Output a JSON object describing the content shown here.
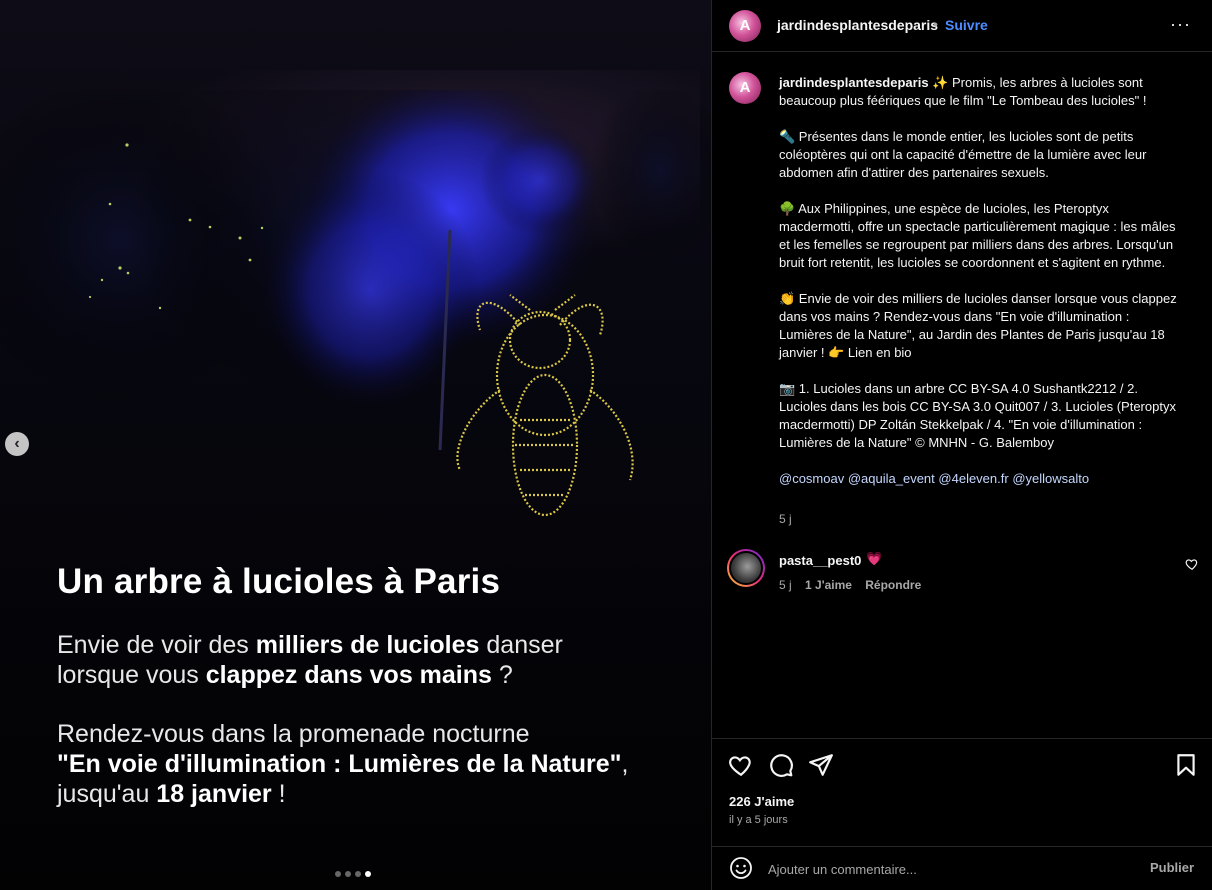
{
  "media": {
    "title": "Un arbre à lucioles à Paris",
    "p1": {
      "l1a": "Envie de voir des ",
      "l1b": "milliers de lucioles",
      "l1c": " danser",
      "l2a": "lorsque vous ",
      "l2b": "clappez dans vos mains",
      "l2c": " ?"
    },
    "p2": {
      "l1": "Rendez-vous dans la promenade nocturne",
      "l2a": "\"En voie d'illumination : Lumières de la Nature\"",
      "l2b": ",",
      "l3a": "jusqu'au ",
      "l3b": "18 janvier",
      "l3c": " !"
    },
    "prev_glyph": "‹",
    "slide_count": 4,
    "active_slide": 4
  },
  "post": {
    "avatar_letter": "A",
    "username": "jardindesplantesdeparis",
    "separator": "•",
    "follow_label": "Suivre",
    "more_glyph": "···"
  },
  "caption": {
    "username": "jardindesplantesdeparis",
    "p1": "✨ Promis, les arbres à lucioles sont beaucoup plus féériques que le film \"Le Tombeau des lucioles\" !",
    "p2": "🔦 Présentes dans le monde entier, les lucioles sont de petits coléoptères qui ont la capacité d'émettre de la lumière avec leur abdomen afin d'attirer des partenaires sexuels.",
    "p3": "🌳 Aux Philippines, une espèce de lucioles, les Pteroptyx macdermotti, offre un spectacle particulièrement magique : les mâles et les femelles se regroupent par milliers dans des arbres. Lorsqu'un bruit fort retentit, les lucioles se coordonnent et s'agitent en rythme.",
    "p4": "👏 Envie de voir des milliers de lucioles danser lorsque vous clappez dans vos mains ? Rendez-vous dans \"En voie d'illumination : Lumières de la Nature\", au Jardin des Plantes de Paris jusqu'au 18 janvier ! 👉 Lien en bio",
    "p5": "📷 1. Lucioles dans un arbre CC BY-SA 4.0 Sushantk2212 / 2. Lucioles dans les bois CC BY-SA 3.0 Quit007 / 3. Lucioles (Pteroptyx macdermotti) DP Zoltán Stekkelpak / 4. \"En voie d'illumination : Lumières de la Nature\" © MNHN - G. Balemboy",
    "mentions": [
      "@cosmoav",
      "@aquila_event",
      "@4eleven.fr",
      "@yellowsalto"
    ],
    "time": "5 j"
  },
  "comment": {
    "username": "pasta__pest0",
    "emoji": "💗",
    "time": "5 j",
    "likes": "1 J'aime",
    "reply": "Répondre"
  },
  "footer": {
    "likes": "226 J'aime",
    "ago": "il y a 5 jours",
    "comment_placeholder": "Ajouter un commentaire...",
    "publish_label": "Publier"
  },
  "colors": {
    "link": "#4d8dff",
    "background": "#000000",
    "border": "#262626",
    "muted": "#a8a8a8"
  }
}
